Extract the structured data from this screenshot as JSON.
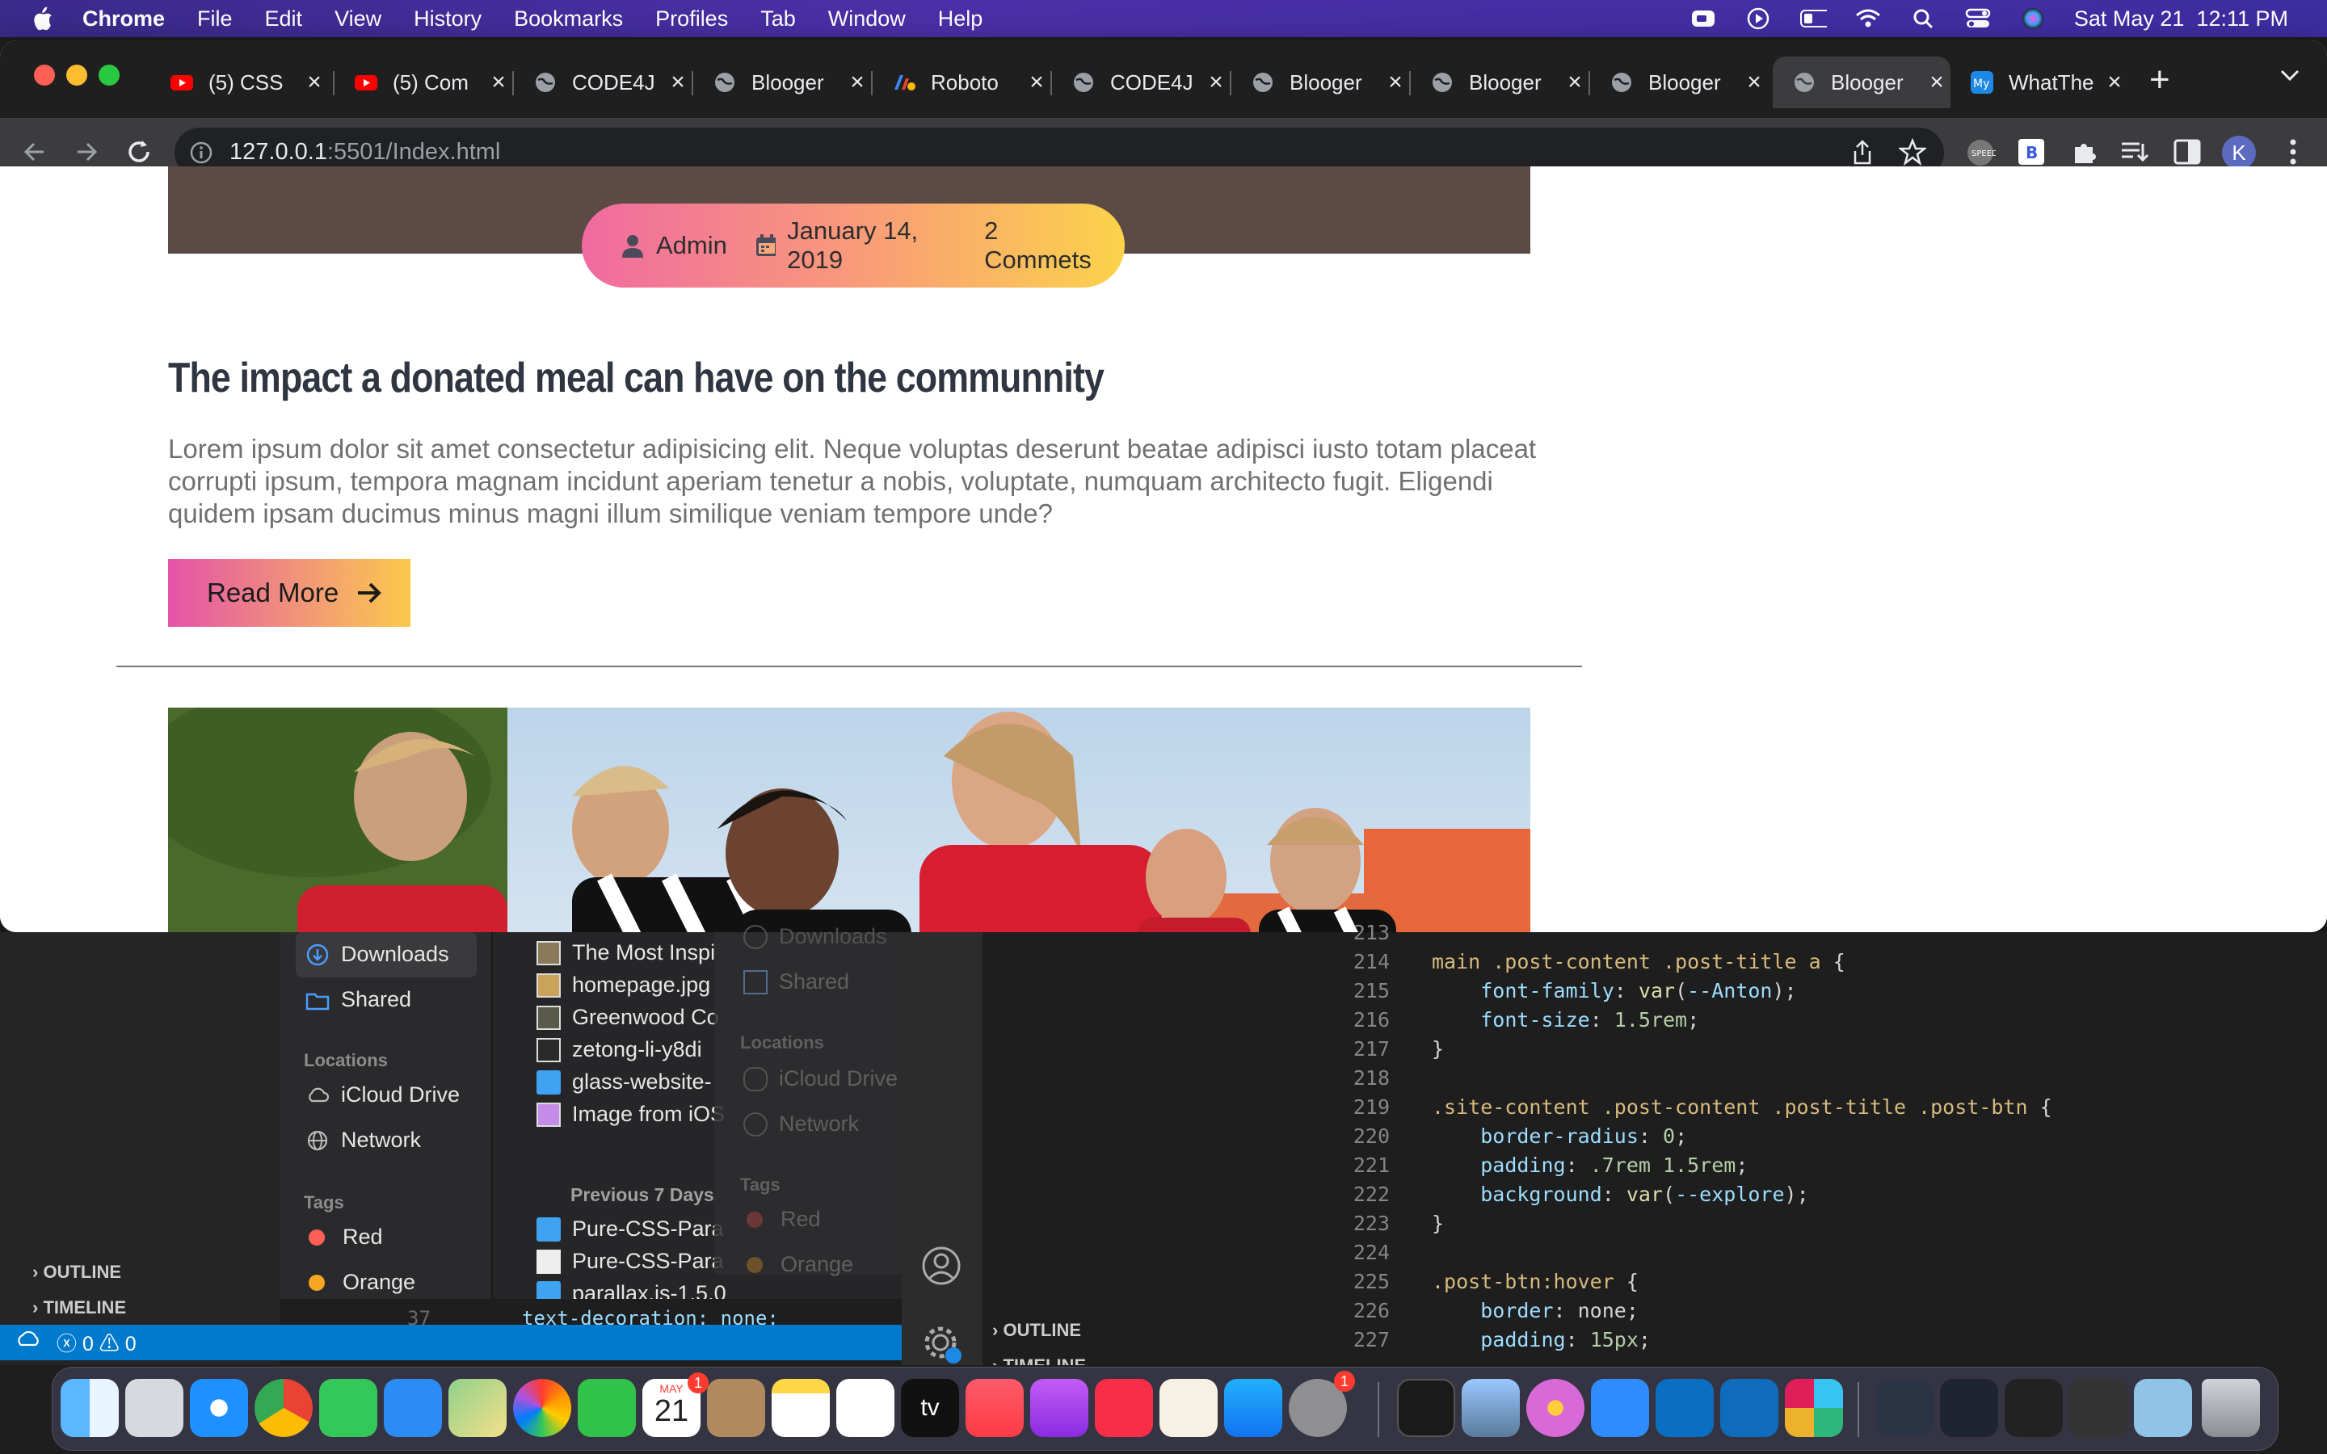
{
  "menubar": {
    "app": "Chrome",
    "items": [
      "File",
      "Edit",
      "View",
      "History",
      "Bookmarks",
      "Profiles",
      "Tab",
      "Window",
      "Help"
    ],
    "clock": "Sat May 21  12:11 PM"
  },
  "tabs": [
    {
      "title": "(5) CSS",
      "icon": "youtube-icon"
    },
    {
      "title": "(5) Com",
      "icon": "youtube-icon"
    },
    {
      "title": "CODE4J",
      "icon": "globe-icon"
    },
    {
      "title": "Blooger",
      "icon": "globe-icon"
    },
    {
      "title": "Roboto",
      "icon": "google-fonts-icon"
    },
    {
      "title": "CODE4J",
      "icon": "globe-icon"
    },
    {
      "title": "Blooger",
      "icon": "globe-icon"
    },
    {
      "title": "Blooger",
      "icon": "globe-icon"
    },
    {
      "title": "Blooger",
      "icon": "globe-icon"
    },
    {
      "title": "Blooger",
      "icon": "globe-icon",
      "active": true
    },
    {
      "title": "WhatThe",
      "icon": "font-icon"
    }
  ],
  "toolbar": {
    "url_host": "127.0.0.1",
    "url_path": ":5501/Index.html",
    "profile_initial": "K"
  },
  "post": {
    "meta_author": "Admin",
    "meta_date": "January 14, 2019",
    "meta_comments": "2 Commets",
    "title": "The impact a donated meal can have on the communnity",
    "excerpt": "Lorem ipsum dolor sit amet consectetur adipisicing elit. Neque voluptas deserunt beatae adipisci iusto totam placeat corrupti ipsum, tempora magnam incidunt aperiam tenetur a nobis, voluptate, numquam architecto fugit. Eligendi quidem ipsam ducimus minus magni illum similique veniam tempore unde?",
    "read_more": "Read More"
  },
  "finder": {
    "sidebar": {
      "downloads": "Downloads",
      "shared": "Shared",
      "locations_head": "Locations",
      "icloud": "iCloud Drive",
      "network": "Network",
      "tags_head": "Tags",
      "tag_red": "Red",
      "tag_orange": "Orange"
    },
    "files": [
      "The Most Inspi",
      "homepage.jpg",
      "Greenwood Co",
      "zetong-li-y8di",
      "glass-website-",
      "Image from iOS"
    ],
    "previous_head": "Previous 7 Days",
    "previous_files": [
      "Pure-CSS-Para",
      "Pure-CSS-Para",
      "parallax.js-1.5.0"
    ],
    "ghost": {
      "downloads": "Downloads",
      "shared": "Shared",
      "locations_head": "Locations",
      "icloud": "iCloud Drive",
      "network": "Network",
      "tags_head": "Tags",
      "tag_red": "Red",
      "tag_orange": "Orange"
    }
  },
  "vscode": {
    "outline": "OUTLINE",
    "timeline": "TIMELINE",
    "outline2": "OUTLINE",
    "timeline2": "TIMELINE",
    "status": "ⓧ 0 ⚠ 0",
    "left_line_number": "37",
    "left_line_code": "text-decoration: none;",
    "code_lines": [
      {
        "n": "213",
        "t": ""
      },
      {
        "n": "214",
        "t": "main .post-content .post-title a {"
      },
      {
        "n": "215",
        "t": "    font-family: var(--Anton);"
      },
      {
        "n": "216",
        "t": "    font-size: 1.5rem;"
      },
      {
        "n": "217",
        "t": "}"
      },
      {
        "n": "218",
        "t": ""
      },
      {
        "n": "219",
        "t": ".site-content .post-content .post-title .post-btn {"
      },
      {
        "n": "220",
        "t": "    border-radius: 0;"
      },
      {
        "n": "221",
        "t": "    padding: .7rem 1.5rem;"
      },
      {
        "n": "222",
        "t": "    background: var(--explore);"
      },
      {
        "n": "223",
        "t": "}"
      },
      {
        "n": "224",
        "t": ""
      },
      {
        "n": "225",
        "t": ".post-btn:hover {"
      },
      {
        "n": "226",
        "t": "    border: none;"
      },
      {
        "n": "227",
        "t": "    padding: 15px;"
      }
    ]
  },
  "dock": {
    "calendar_month": "MAY",
    "calendar_day": "21",
    "badge_calendar": "1",
    "badge_settings": "1",
    "tv_label": "tv"
  },
  "colors": {
    "accent_gradient_start": "#f06aa0",
    "accent_gradient_end": "#fbd34a",
    "title": "#2f3541",
    "text": "#707070"
  }
}
